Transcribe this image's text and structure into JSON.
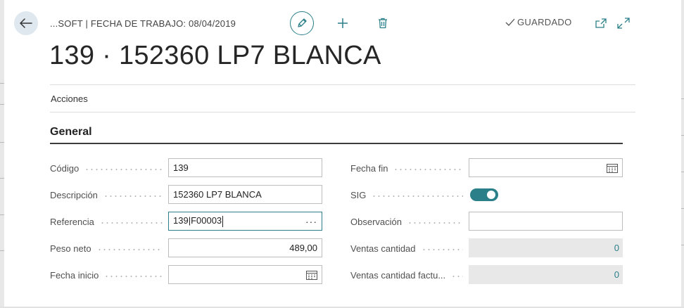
{
  "header": {
    "breadcrumb": "...SOFT | FECHA DE TRABAJO: 08/04/2019",
    "saved_status": "GUARDADO"
  },
  "page": {
    "title": "139 · 152360 LP7 BLANCA",
    "actions_label": "Acciones",
    "section_title": "General"
  },
  "fields_left": [
    {
      "label": "Código",
      "value": "139"
    },
    {
      "label": "Descripción",
      "value": "152360 LP7 BLANCA"
    },
    {
      "label": "Referencia",
      "value": "139|F00003"
    },
    {
      "label": "Peso neto",
      "value": "489,00"
    },
    {
      "label": "Fecha inicio",
      "value": ""
    }
  ],
  "fields_right": [
    {
      "label": "Fecha fin",
      "value": ""
    },
    {
      "label": "SIG",
      "value": "on"
    },
    {
      "label": "Observación",
      "value": ""
    },
    {
      "label": "Ventas cantidad",
      "value": "0"
    },
    {
      "label": "Ventas cantidad factu...",
      "value": "0"
    }
  ],
  "icons": {
    "back": "arrow-left-icon",
    "edit": "pencil-icon",
    "new": "plus-icon",
    "delete": "trash-icon",
    "saved": "checkmark-icon",
    "popout": "open-in-new-window-icon",
    "expand": "expand-icon",
    "calendar": "calendar-icon",
    "lookup": "ellipsis-icon"
  },
  "colors": {
    "accent": "#2a7f89",
    "back_button_bg": "#dfe8ef",
    "readonly_bg": "#e8e8e8"
  }
}
